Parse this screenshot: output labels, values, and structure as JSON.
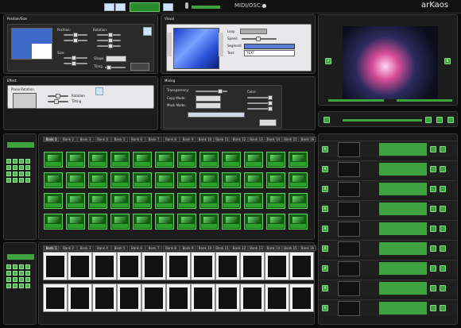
{
  "topbar": {
    "center_label": "",
    "midi_osc": "MIDI/OSC:",
    "meter_label": "",
    "brand": "arKaos"
  },
  "colors": {
    "accent_green": "#3ea33e",
    "panel_bg": "#1c1c1c",
    "subpanel_bg": "#e8e8ea"
  },
  "position_size": {
    "title": "Position/Size",
    "position": "Position:",
    "rotation": "Rotation:",
    "size": "Size:",
    "shape": "Shape",
    "tiling": "Tiling"
  },
  "visual": {
    "title": "Visual",
    "loop": "Loop",
    "speed": "Speed",
    "segment": "Segment",
    "text_label": "Text:",
    "text_value": "TEXT"
  },
  "effect": {
    "title": "Effect",
    "effect_name": "Plane Rotation",
    "rotation_label": "Rotation",
    "tilting": "Tilting"
  },
  "mixing": {
    "title": "Mixing",
    "transparency": "Transparency:",
    "copy_mode": "Copy Mode:",
    "mask_mode": "Mask Mode:",
    "color": "Color:"
  },
  "banks_top": [
    "Bank 1",
    "Bank 2",
    "Bank 3",
    "Bank 4",
    "Bank 5",
    "Bank 6",
    "Bank 7",
    "Bank 8",
    "Bank 9",
    "Bank 10",
    "Bank 11",
    "Bank 12",
    "Bank 13",
    "Bank 14",
    "Bank 15",
    "Bank 16"
  ],
  "banks_bottom": [
    "Bank 1",
    "Bank 2",
    "Bank 3",
    "Bank 4",
    "Bank 5",
    "Bank 6",
    "Bank 7",
    "Bank 8",
    "Bank 9",
    "Bank 10",
    "Bank 11",
    "Bank 12",
    "Bank 13",
    "Bank 14",
    "Bank 15",
    "Bank 16"
  ],
  "sidebar": {
    "top_label": "",
    "bottom_label": ""
  },
  "layers": [
    {
      "letter": "A",
      "value": ""
    },
    {
      "letter": "A",
      "value": ""
    },
    {
      "letter": "A",
      "value": ""
    },
    {
      "letter": "A",
      "value": ""
    },
    {
      "letter": "A",
      "value": ""
    },
    {
      "letter": "A",
      "value": ""
    },
    {
      "letter": "A",
      "value": ""
    },
    {
      "letter": "A",
      "value": ""
    },
    {
      "letter": "A",
      "value": ""
    }
  ],
  "preview": {
    "left_btn": "A",
    "right_btn": "B"
  },
  "icons": [
    "menu-icon",
    "play-icon",
    "mic-icon",
    "gear-icon",
    "chevron-left-icon",
    "chevron-right-icon",
    "lock-icon"
  ]
}
